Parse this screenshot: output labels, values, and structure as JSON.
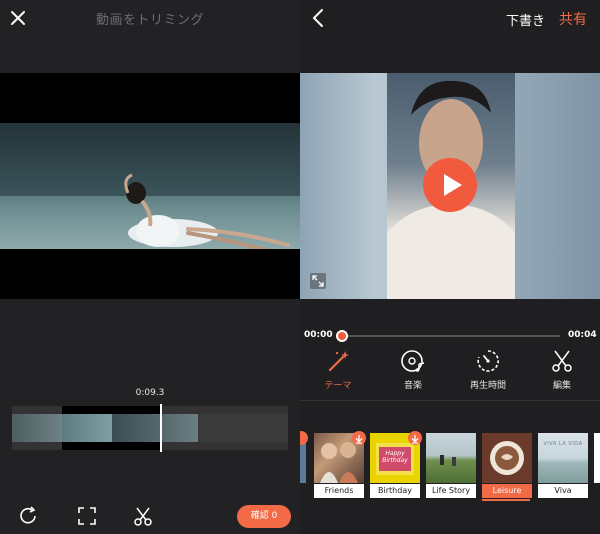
{
  "left": {
    "title": "動画をトリミング",
    "timecode": "0:09.3",
    "confirm_label": "確認 0",
    "icons": [
      "close-icon",
      "rotate-icon",
      "crop-icon",
      "scissors-icon"
    ]
  },
  "right": {
    "draft_label": "下書き",
    "share_label": "共有",
    "time_start": "00:00",
    "time_end": "00:04",
    "playback_progress": 0.0,
    "tabs": [
      {
        "label": "テーマ",
        "icon": "magic-wand-icon",
        "active": true
      },
      {
        "label": "音楽",
        "icon": "music-disc-icon",
        "active": false
      },
      {
        "label": "再生時間",
        "icon": "timer-icon",
        "active": false
      },
      {
        "label": "編集",
        "icon": "scissors-icon",
        "active": false
      }
    ],
    "themes": [
      {
        "label": "Friends",
        "download": true,
        "active": false
      },
      {
        "label": "Birthday",
        "download": true,
        "active": false,
        "art_text": "Happy Birthday"
      },
      {
        "label": "Life Story",
        "download": false,
        "active": false
      },
      {
        "label": "Leisure",
        "download": false,
        "active": true
      },
      {
        "label": "Viva",
        "download": false,
        "active": false,
        "art_text": "VIVA LA VIDA"
      }
    ],
    "accent_color": "#f26a46"
  }
}
